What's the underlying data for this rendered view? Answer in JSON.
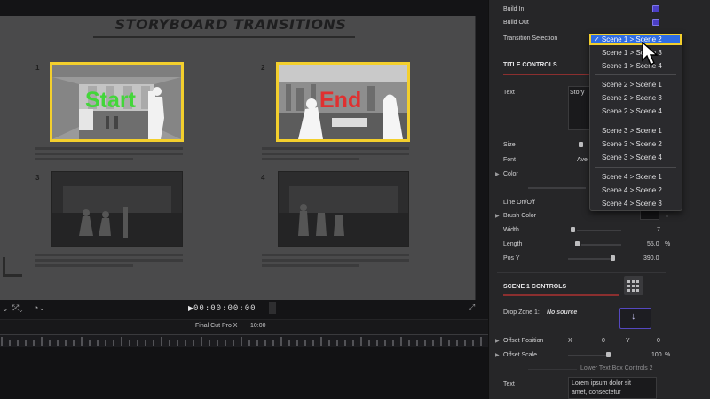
{
  "storyboard": {
    "title": "STORYBOARD TRANSITIONS",
    "panels": [
      {
        "number": "1",
        "label": "Start",
        "label_color": "#43d63a"
      },
      {
        "number": "2",
        "label": "End",
        "label_color": "#e03030"
      },
      {
        "number": "3"
      },
      {
        "number": "4"
      }
    ]
  },
  "transport": {
    "timecode": "00:00:00:00"
  },
  "timeline": {
    "project_name": "Final Cut Pro X",
    "duration": "10:00"
  },
  "inspector": {
    "build_in": "Build In",
    "build_out": "Build Out",
    "transition_selection": "Transition Selection",
    "title_controls": "TITLE CONTROLS",
    "text_label": "Text",
    "text_value": "Story",
    "size_label": "Size",
    "font_label": "Font",
    "font_value": "Ave",
    "color_label": "Color",
    "line_onoff": "Line On/Off",
    "brush_color": "Brush Color",
    "width_label": "Width",
    "width_value": "7",
    "length_label": "Length",
    "length_value": "55.0",
    "length_unit": "%",
    "posy_label": "Pos Y",
    "posy_value": "390.0",
    "scene1_controls": "SCENE 1 CONTROLS",
    "drop_zone_label": "Drop Zone 1:",
    "drop_zone_value": "No source",
    "offset_position": "Offset Position",
    "x_label": "X",
    "x_value": "0",
    "y_label": "Y",
    "y_value": "0",
    "offset_scale": "Offset Scale",
    "offset_scale_value": "100",
    "offset_scale_unit": "%",
    "lower_text_box": "Lower Text Box Controls 2",
    "text2_label": "Text",
    "text2_value_line1": "Lorem ipsum dolor sit",
    "text2_value_line2": "amet, consectetur"
  },
  "dropdown": {
    "selected": "✓ Scene 1 > Scene 2",
    "groups": [
      [
        "Scene 1 > Scene 3",
        "Scene 1 > Scene 4"
      ],
      [
        "Scene 2 > Scene 1",
        "Scene 2 > Scene 3",
        "Scene 2 > Scene 4"
      ],
      [
        "Scene 3 > Scene 1",
        "Scene 3 > Scene 2",
        "Scene 3 > Scene 4"
      ],
      [
        "Scene 4 > Scene 1",
        "Scene 4 > Scene 2",
        "Scene 4 > Scene 3"
      ]
    ]
  },
  "colors": {
    "highlight": "#f3cf2d",
    "selection_blue": "#2f6de4",
    "checkbox_purple": "#4b3fc6"
  },
  "icons": [
    "play-icon",
    "fullscreen-icon",
    "transform-icon",
    "speed-icon",
    "arrow-down-icon",
    "grid-icon",
    "pointer-cursor-icon"
  ]
}
